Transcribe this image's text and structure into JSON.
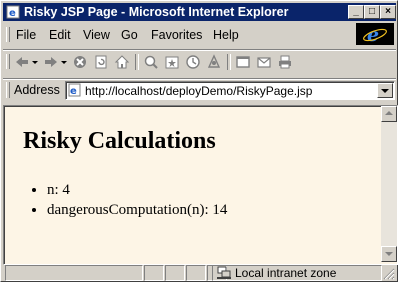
{
  "window": {
    "title": "Risky JSP Page - Microsoft Internet Explorer",
    "controls": {
      "minimize": "_",
      "maximize": "□",
      "close": "×"
    }
  },
  "menu": {
    "file": "File",
    "edit": "Edit",
    "view": "View",
    "go": "Go",
    "favorites": "Favorites",
    "help": "Help"
  },
  "toolbar": {
    "icons": [
      "back-icon",
      "forward-icon",
      "stop-icon",
      "refresh-icon",
      "home-icon",
      "search-icon",
      "favorites-icon",
      "history-icon",
      "channels-icon",
      "fullscreen-icon",
      "mail-icon",
      "print-icon"
    ]
  },
  "address": {
    "label": "Address",
    "url": "http://localhost/deployDemo/RiskyPage.jsp"
  },
  "page": {
    "heading": "Risky Calculations",
    "items": [
      "n: 4",
      "dangerousComputation(n): 14"
    ],
    "background": "#fdf5e6"
  },
  "status": {
    "zone": "Local intranet zone"
  },
  "colors": {
    "titlebar": "#0a246a",
    "chrome": "#d4d0c8"
  }
}
